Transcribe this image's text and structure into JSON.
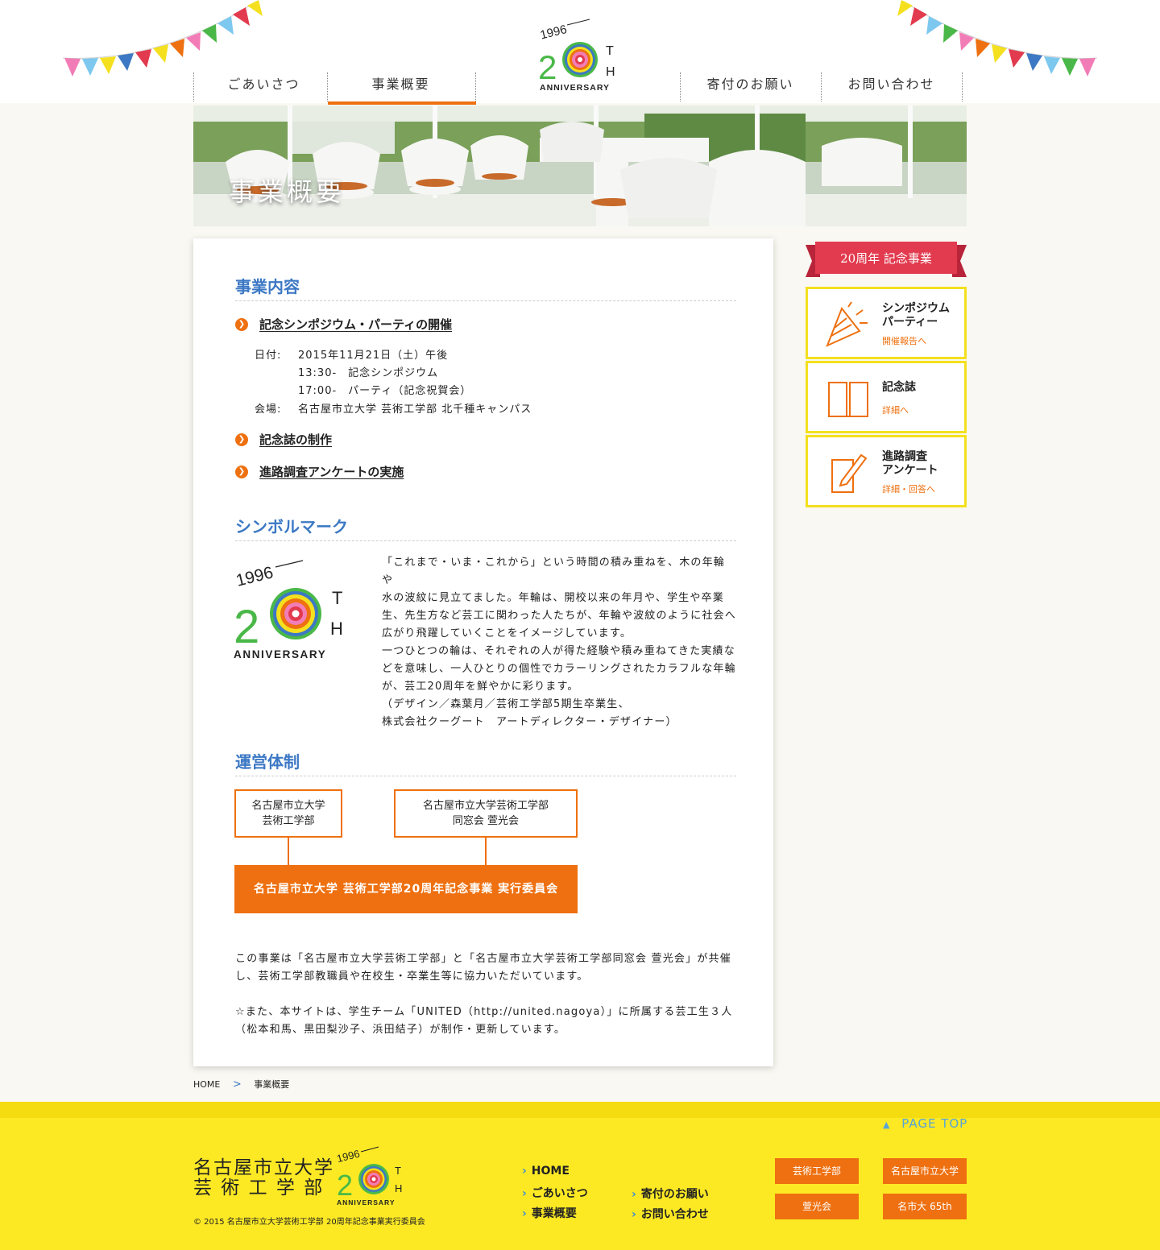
{
  "nav": {
    "items": [
      {
        "label": "ごあいさつ"
      },
      {
        "label": "事業概要"
      },
      {
        "label": "寄付のお願い"
      },
      {
        "label": "お問い合わせ"
      }
    ],
    "active_index": 1
  },
  "logo": {
    "year": "1996",
    "num": "20",
    "th": "TH",
    "text": "ANNIVERSARY"
  },
  "hero": {
    "title": "事業概要"
  },
  "section1": {
    "heading": "事業内容",
    "item1": {
      "label": "記念シンポジウム・パーティの開催",
      "date_label": "日付:",
      "date_value": "2015年11月21日（土）午後",
      "time1": "13:30-　記念シンポジウム",
      "time2": "17:00-　パーティ（記念祝賀会）",
      "venue_label": "会場:",
      "venue_value": "名古屋市立大学 芸術工学部 北千種キャンパス"
    },
    "item2": {
      "label": "記念誌の制作"
    },
    "item3": {
      "label": "進路調査アンケートの実施"
    }
  },
  "section2": {
    "heading": "シンボルマーク",
    "lines": [
      "「これまで・いま・これから」という時間の積み重ねを、木の年輪や",
      "水の波紋に見立てました。年輪は、開校以来の年月や、学生や卒業",
      "生、先生方など芸工に関わった人たちが、年輪や波紋のように社会へ",
      "広がり飛躍していくことをイメージしています。",
      "一つひとつの輪は、それぞれの人が得た経験や積み重ねてきた実績な",
      "どを意味し、一人ひとりの個性でカラーリングされたカラフルな年輪",
      "が、芸工20周年を鮮やかに彩ります。",
      "（デザイン／森葉月／芸術工学部5期生卒業生、",
      "株式会社クーグート　アートディレクター・デザイナー）"
    ]
  },
  "section3": {
    "heading": "運営体制",
    "box1_l1": "名古屋市立大学",
    "box1_l2": "芸術工学部",
    "box2_l1": "名古屋市立大学芸術工学部",
    "box2_l2": "同窓会 萱光会",
    "committee": "名古屋市立大学 芸術工学部20周年記念事業 実行委員会",
    "note_lines": [
      "この事業は「名古屋市立大学芸術工学部」と「名古屋市立大学芸術工学部同窓会 萱光会」が共催",
      "し、芸術工学部教職員や在校生・卒業生等に協力いただいています。",
      "",
      "☆また、本サイトは、学生チーム「UNITED（http://united.nagoya）」に所属する芸工生３人",
      "（松本和馬、黒田梨沙子、浜田結子）が制作・更新しています。"
    ]
  },
  "sidebar": {
    "ribbon": "20周年 記念事業",
    "cards": [
      {
        "title1": "シンポジウム",
        "title2": "パーティー",
        "sub": "開催報告へ"
      },
      {
        "title1": "記念誌",
        "title2": "",
        "sub": "詳細へ"
      },
      {
        "title1": "進路調査",
        "title2": "アンケート",
        "sub": "詳細・回答へ"
      }
    ]
  },
  "breadcrumb": {
    "home": "HOME",
    "sep": ">",
    "current": "事業概要"
  },
  "footer": {
    "pagetop": "PAGE TOP",
    "title_l1": "名古屋市立大学",
    "title_l2": "芸 術 工 学 部",
    "copyright": "© 2015 名古屋市立大学芸術工学部 20周年記念事業実行委員会",
    "links": [
      "HOME",
      "ごあいさつ",
      "事業概要",
      "寄付のお願い",
      "お問い合わせ"
    ],
    "buttons": [
      "芸術工学部",
      "名古屋市立大学",
      "萱光会",
      "名市大 65th"
    ]
  },
  "colors": {
    "accent": "#ee7010",
    "heading_blue": "#3c78c4",
    "footer_yellow": "#fce924",
    "card_border": "#f4e01e",
    "ribbon_red": "#e23a4e"
  }
}
